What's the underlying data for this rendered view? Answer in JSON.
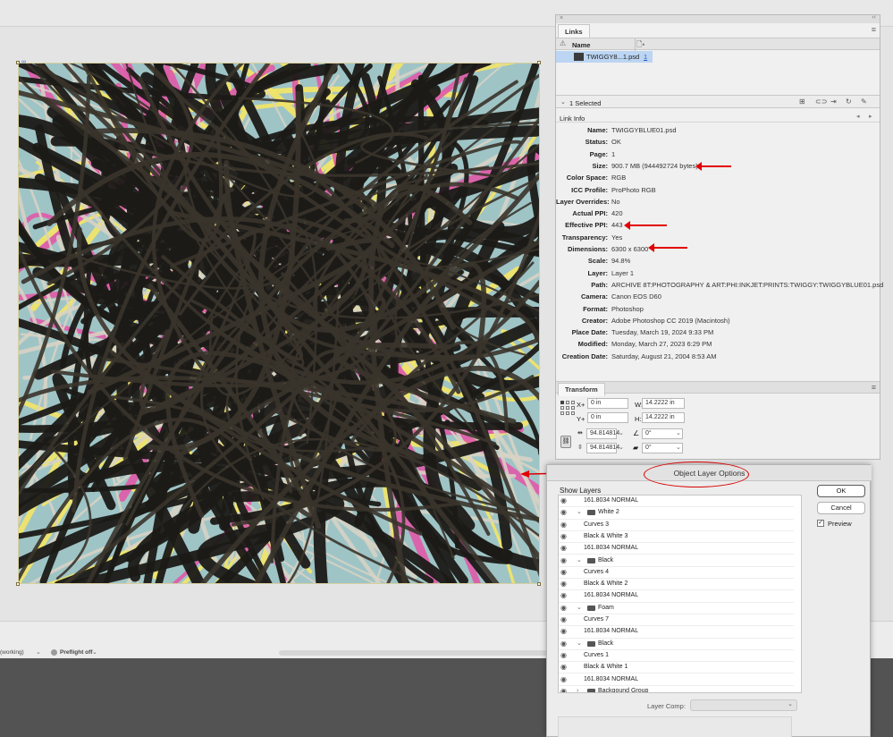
{
  "canvas": {
    "status": {
      "working": "(working)",
      "preflight": "Preflight off"
    }
  },
  "links_panel": {
    "tab": "Links",
    "column_name": "Name",
    "file_row": {
      "name": "TWIGGY8...1.psd",
      "page": "1"
    },
    "selected_count": "1 Selected",
    "link_info_title": "Link Info",
    "info": [
      {
        "label": "Name:",
        "value": "TWIGGYBLUE01.psd"
      },
      {
        "label": "Status:",
        "value": "OK"
      },
      {
        "label": "Page:",
        "value": "1"
      },
      {
        "label": "Size:",
        "value": "900.7 MB (944492724 bytes)"
      },
      {
        "label": "Color Space:",
        "value": "RGB"
      },
      {
        "label": "ICC Profile:",
        "value": "ProPhoto RGB"
      },
      {
        "label": "Layer Overrides:",
        "value": "No"
      },
      {
        "label": "Actual PPI:",
        "value": "420"
      },
      {
        "label": "Effective PPI:",
        "value": "443"
      },
      {
        "label": "Transparency:",
        "value": "Yes"
      },
      {
        "label": "Dimensions:",
        "value": "6300 x 6300"
      },
      {
        "label": "Scale:",
        "value": "94.8%"
      },
      {
        "label": "Layer:",
        "value": "Layer 1"
      },
      {
        "label": "Path:",
        "value": "ARCHIVE 8T:PHOTOGRAPHY & ART:PHI:INKJET:PRINTS:TWIGGY:TWIGGYBLUE01.psd"
      },
      {
        "label": "Camera:",
        "value": "Canon EOS D60"
      },
      {
        "label": "Format:",
        "value": "Photoshop"
      },
      {
        "label": "Creator:",
        "value": "Adobe Photoshop CC 2019 (Macintosh)"
      },
      {
        "label": "Place Date:",
        "value": "Tuesday, March 19, 2024 9:33 PM"
      },
      {
        "label": "Modified:",
        "value": "Monday, March 27, 2023 6:29 PM"
      },
      {
        "label": "Creation Date:",
        "value": "Saturday, August 21, 2004 8:53 AM"
      }
    ]
  },
  "transform_panel": {
    "tab": "Transform",
    "x_label": "X+",
    "x_value": "0 in",
    "y_label": "Y+",
    "y_value": "0 in",
    "w_label": "W:",
    "w_value": "14.2222 in",
    "h_label": "H:",
    "h_value": "14.2222 in",
    "scale_x": "94.814814",
    "scale_y": "94.814814",
    "rotate": "0°",
    "shear": "0°"
  },
  "dialog": {
    "title": "Object Layer Options",
    "show_layers": "Show Layers",
    "ok": "OK",
    "cancel": "Cancel",
    "preview": "Preview",
    "layer_comp_label": "Layer Comp:",
    "layers": [
      {
        "name": "161.8034 NORMAL",
        "indent": 1,
        "group": false,
        "expanded": null
      },
      {
        "name": "White 2",
        "indent": 0,
        "group": true,
        "expanded": true
      },
      {
        "name": "Curves 3",
        "indent": 1,
        "group": false,
        "expanded": null
      },
      {
        "name": "Black & White 3",
        "indent": 1,
        "group": false,
        "expanded": null
      },
      {
        "name": "161.8034 NORMAL",
        "indent": 1,
        "group": false,
        "expanded": null
      },
      {
        "name": "Black",
        "indent": 0,
        "group": true,
        "expanded": true
      },
      {
        "name": "Curves 4",
        "indent": 1,
        "group": false,
        "expanded": null
      },
      {
        "name": "Black & White 2",
        "indent": 1,
        "group": false,
        "expanded": null
      },
      {
        "name": "161.8034 NORMAL",
        "indent": 1,
        "group": false,
        "expanded": null
      },
      {
        "name": "Foam",
        "indent": 0,
        "group": true,
        "expanded": true
      },
      {
        "name": "Curves 7",
        "indent": 1,
        "group": false,
        "expanded": null
      },
      {
        "name": "161.8034 NORMAL",
        "indent": 1,
        "group": false,
        "expanded": null
      },
      {
        "name": "Black",
        "indent": 0,
        "group": true,
        "expanded": true
      },
      {
        "name": "Curves 1",
        "indent": 1,
        "group": false,
        "expanded": null
      },
      {
        "name": "Black & White 1",
        "indent": 1,
        "group": false,
        "expanded": null
      },
      {
        "name": "161.8034 NORMAL",
        "indent": 1,
        "group": false,
        "expanded": null
      },
      {
        "name": "Backgound Group",
        "indent": 0,
        "group": true,
        "expanded": false
      }
    ]
  },
  "colors": {
    "annotation_red": "#e30000",
    "selection_blue": "#bcd5f2",
    "panel_bg": "#f0f0f0"
  }
}
